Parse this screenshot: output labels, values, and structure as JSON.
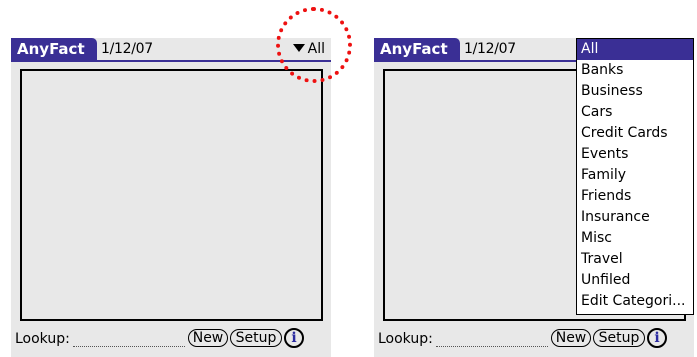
{
  "app": {
    "title": "AnyFact",
    "date": "1/12/07"
  },
  "category": {
    "selected": "All"
  },
  "lookup": {
    "label": "Lookup:"
  },
  "buttons": {
    "new": "New",
    "setup": "Setup",
    "info": "i"
  },
  "dropdown": {
    "options": [
      "All",
      "Banks",
      "Business",
      "Cars",
      "Credit Cards",
      "Events",
      "Family",
      "Friends",
      "Insurance",
      "Misc",
      "Travel",
      "Unfiled",
      "Edit Categori..."
    ]
  },
  "colors": {
    "accent": "#3a2f95",
    "highlight": "#ee1111",
    "screen_bg": "#e8e8e8"
  }
}
